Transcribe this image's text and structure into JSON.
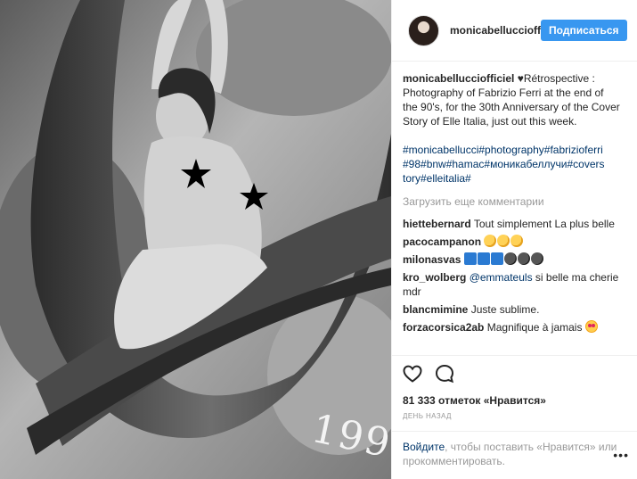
{
  "post": {
    "username": "monicabellucciofficiel",
    "header_username": "monicabelluccioff",
    "follow_label": "Подписаться",
    "caption_user": "monicabellucciofficiel",
    "caption_text": "♥Rétrospective : Photography of Fabrizio Ferri at the end of the 90's, for the 30th Anniversary of the Cover Story of Elle Italia, just out this week.",
    "hashtags": "#monicabellucci#photography#fabrizioferri #98#bnw#hamac#моникабеллучи#covers tory#elleitalia#",
    "load_more": "Загрузить еще комментарии",
    "photo_text": "199"
  },
  "comments": [
    {
      "user": "hiettebernard",
      "text": "Tout simplement La plus belle"
    },
    {
      "user": "pacocampanon",
      "text": ""
    },
    {
      "user": "milonasvas",
      "text": ""
    },
    {
      "user": "kro_wolberg",
      "mention": "@emmateuls",
      "text": " si belle ma cherie mdr"
    },
    {
      "user": "blancmimine",
      "text": "Juste sublime."
    },
    {
      "user": "forzacorsica2ab",
      "text": "Magnifique à jamais"
    }
  ],
  "emoji": {
    "pacocampanon": [
      "clapping-hands",
      "clapping-hands",
      "clapping-hands"
    ],
    "milonasvas": [
      "hundred",
      "hundred",
      "hundred",
      "bomb",
      "bomb",
      "bomb"
    ],
    "forzacorsica2ab": [
      "heart-eyes"
    ]
  },
  "actions": {
    "likes_count": "81 333",
    "likes_word": "отметок",
    "likes_suffix": "«Нравится»",
    "time": "день назад",
    "like_icon": "heart-icon",
    "comment_icon": "comment-bubble-icon"
  },
  "add_comment": {
    "login_link": "Войдите",
    "text": ", чтобы поставить «Нравится» или прокомментировать.",
    "more_icon": "more-options-icon"
  },
  "colors": {
    "accent": "#3897f0",
    "link": "#003569",
    "muted": "#999999",
    "text": "#262626"
  }
}
